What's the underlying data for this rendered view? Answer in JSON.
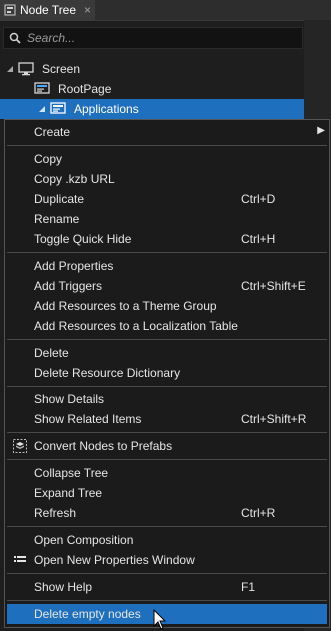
{
  "panel": {
    "tab_label": "Node Tree",
    "tab_close": "×",
    "tab_icon": "node-tree-icon"
  },
  "search": {
    "placeholder": "Search...",
    "icon": "search-icon"
  },
  "tree": {
    "nodes": [
      {
        "label": "Screen",
        "icon": "screen-icon",
        "expanded": true
      },
      {
        "label": "RootPage",
        "icon": "page-icon",
        "expanded": false
      },
      {
        "label": "Applications",
        "icon": "page-icon",
        "expanded": true,
        "selected": true
      }
    ]
  },
  "menu": {
    "items": {
      "create": "Create",
      "copy": "Copy",
      "copy_kzb_url": "Copy .kzb URL",
      "duplicate": "Duplicate",
      "duplicate_shortcut": "Ctrl+D",
      "rename": "Rename",
      "toggle_quick_hide": "Toggle Quick Hide",
      "toggle_quick_hide_shortcut": "Ctrl+H",
      "add_properties": "Add Properties",
      "add_triggers": "Add Triggers",
      "add_triggers_shortcut": "Ctrl+Shift+E",
      "add_resources_theme": "Add Resources to a Theme Group",
      "add_resources_localization": "Add Resources to a Localization Table",
      "delete": "Delete",
      "delete_resource_dictionary": "Delete Resource Dictionary",
      "show_details": "Show Details",
      "show_related_items": "Show Related Items",
      "show_related_items_shortcut": "Ctrl+Shift+R",
      "convert_to_prefabs": "Convert Nodes to Prefabs",
      "collapse_tree": "Collapse Tree",
      "expand_tree": "Expand Tree",
      "refresh": "Refresh",
      "refresh_shortcut": "Ctrl+R",
      "open_composition": "Open Composition",
      "open_properties_window": "Open New Properties Window",
      "show_help": "Show Help",
      "show_help_shortcut": "F1",
      "delete_empty_nodes": "Delete empty nodes"
    },
    "hovered_item": "Delete empty nodes",
    "submenu_arrow": "▶"
  },
  "colors": {
    "selection": "#1f6fbf",
    "background": "#1e1e1e",
    "menu_bg": "#1b1b1b",
    "text": "#e6e6e6"
  }
}
